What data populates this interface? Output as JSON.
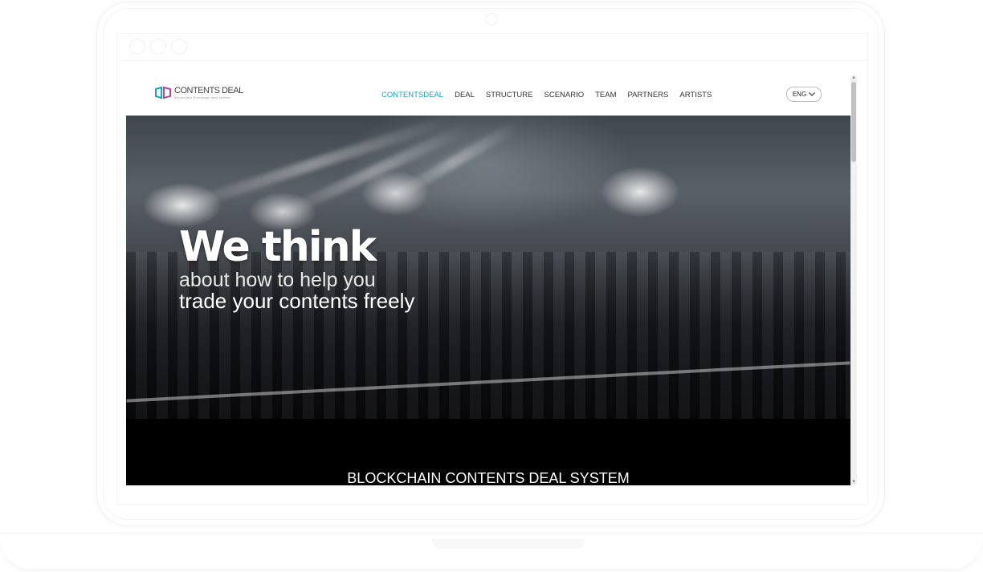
{
  "site": {
    "logo": {
      "name": "CONTENTS DEAL",
      "tagline": "Blockchain Exchange deal system"
    },
    "nav": [
      {
        "label": "CONTENTSDEAL",
        "active": true
      },
      {
        "label": "DEAL",
        "active": false
      },
      {
        "label": "STRUCTURE",
        "active": false
      },
      {
        "label": "SCENARIO",
        "active": false
      },
      {
        "label": "TEAM",
        "active": false
      },
      {
        "label": "PARTNERS",
        "active": false
      },
      {
        "label": "ARTISTS",
        "active": false
      }
    ],
    "language": {
      "selected": "ENG",
      "icon": "chevron-down-icon"
    },
    "hero": {
      "line1": "We think",
      "line2": "about how to help you",
      "line3": "trade your contents freely"
    },
    "section": {
      "title": "BLOCKCHAIN CONTENTS DEAL SYSTEM"
    }
  },
  "colors": {
    "accent": "#19a3b8",
    "nav_text": "#333333",
    "section_bg": "#000000"
  }
}
